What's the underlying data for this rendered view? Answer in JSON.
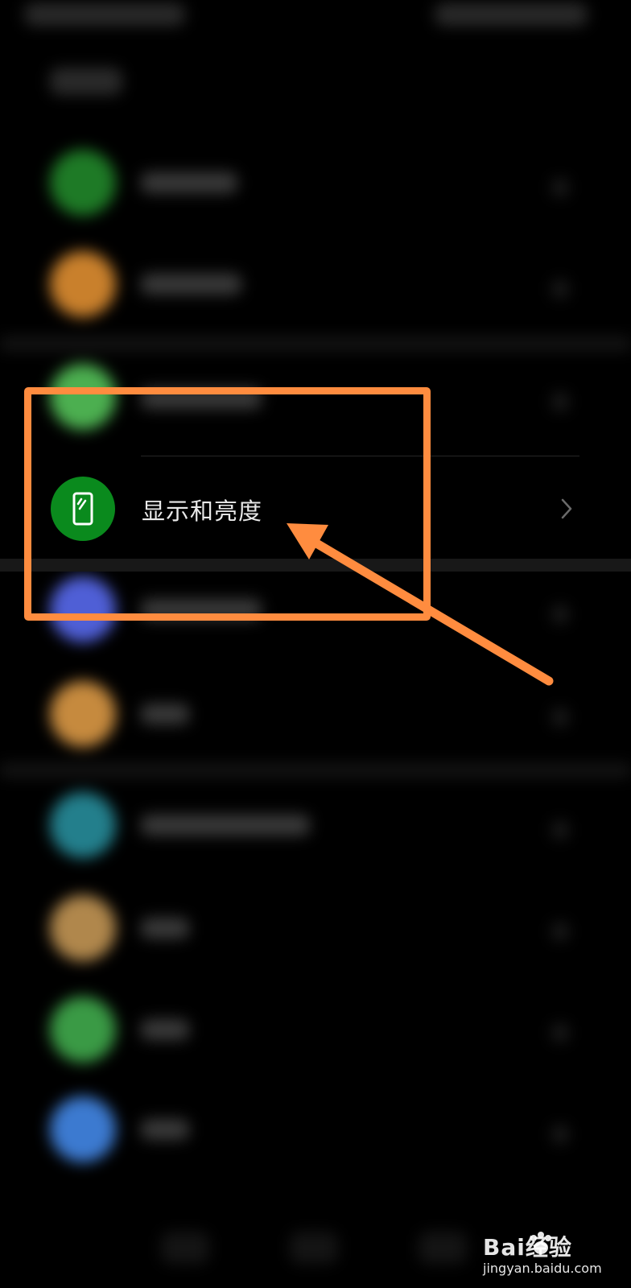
{
  "settings_item": {
    "label": "显示和亮度",
    "icon": "phone-display-icon",
    "icon_color": "#0a8a1d"
  },
  "annotation": {
    "color": "#ff8c3f"
  },
  "watermark": {
    "brand": "Bai经验",
    "url": "jingyan.baidu.com"
  }
}
